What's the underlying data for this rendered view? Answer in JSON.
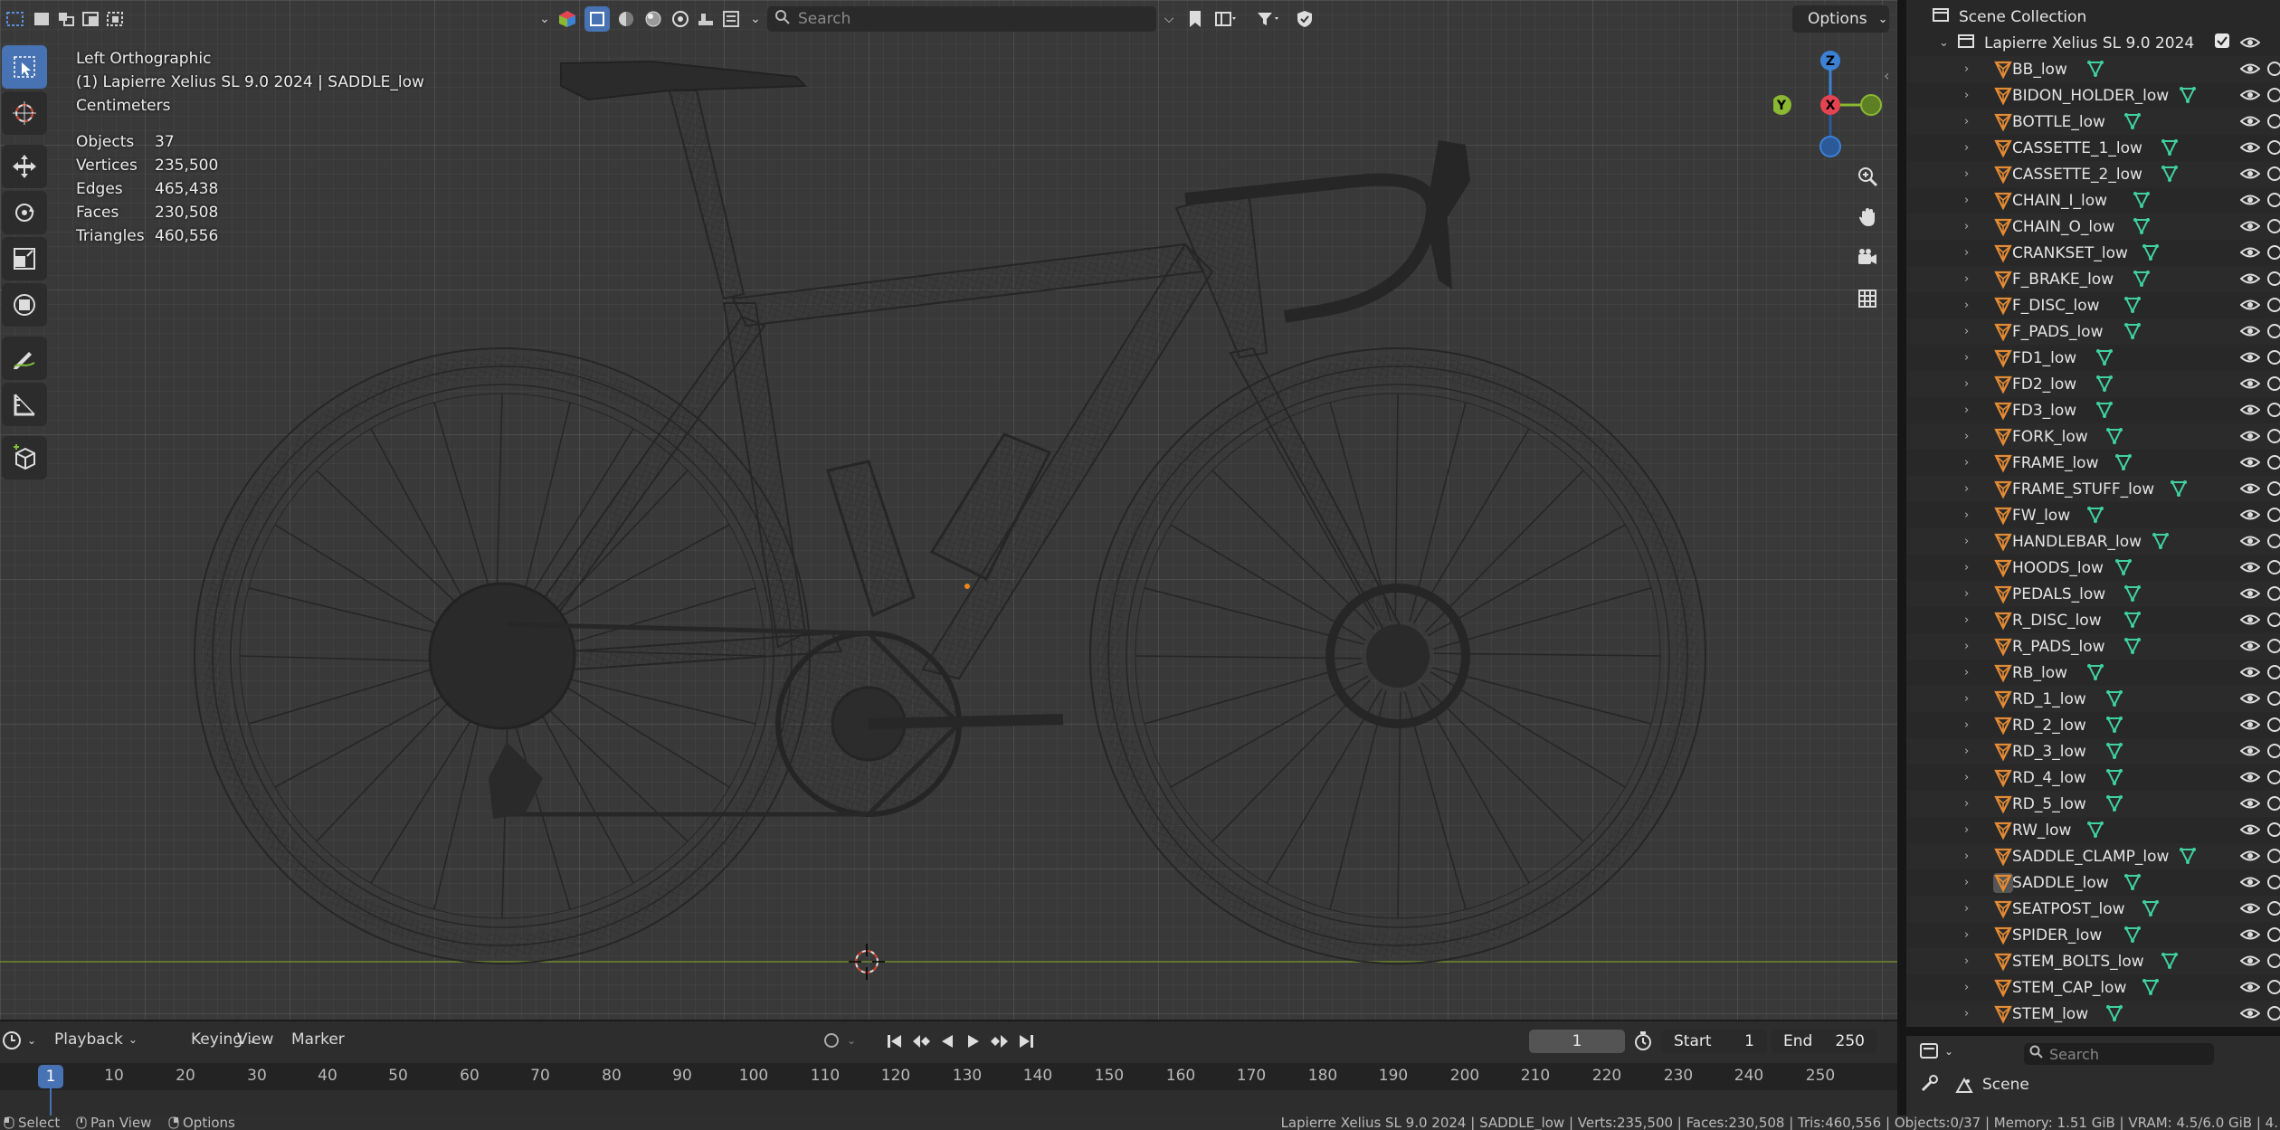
{
  "viewport": {
    "header": {
      "search_placeholder": "Search",
      "options_label": "Options"
    },
    "overlay": {
      "view_name": "Left Orthographic",
      "object_context": "(1) Lapierre Xelius SL 9.0 2024 | SADDLE_low",
      "units": "Centimeters",
      "stats": [
        {
          "label": "Objects",
          "value": "37"
        },
        {
          "label": "Vertices",
          "value": "235,500"
        },
        {
          "label": "Edges",
          "value": "465,438"
        },
        {
          "label": "Faces",
          "value": "230,508"
        },
        {
          "label": "Triangles",
          "value": "460,556"
        }
      ]
    },
    "gizmo": {
      "z": "Z",
      "y": "Y",
      "x": "X"
    }
  },
  "timeline": {
    "menus": [
      "Playback",
      "Keying",
      "View",
      "Marker"
    ],
    "current_frame": "1",
    "start_label": "Start",
    "start_value": "1",
    "end_label": "End",
    "end_value": "250",
    "ruler_ticks": [
      "1",
      "10",
      "20",
      "30",
      "40",
      "50",
      "60",
      "70",
      "80",
      "90",
      "100",
      "110",
      "120",
      "130",
      "140",
      "150",
      "160",
      "170",
      "180",
      "190",
      "200",
      "210",
      "220",
      "230",
      "240",
      "250"
    ]
  },
  "outliner": {
    "scene_collection": "Scene Collection",
    "collection_name": "Lapierre Xelius SL 9.0 2024",
    "objects": [
      "BB_low",
      "BIDON_HOLDER_low",
      "BOTTLE_low",
      "CASSETTE_1_low",
      "CASSETTE_2_low",
      "CHAIN_I_low",
      "CHAIN_O_low",
      "CRANKSET_low",
      "F_BRAKE_low",
      "F_DISC_low",
      "F_PADS_low",
      "FD1_low",
      "FD2_low",
      "FD3_low",
      "FORK_low",
      "FRAME_low",
      "FRAME_STUFF_low",
      "FW_low",
      "HANDLEBAR_low",
      "HOODS_low",
      "PEDALS_low",
      "R_DISC_low",
      "R_PADS_low",
      "RB_low",
      "RD_1_low",
      "RD_2_low",
      "RD_3_low",
      "RD_4_low",
      "RD_5_low",
      "RW_low",
      "SADDLE_CLAMP_low",
      "SADDLE_low",
      "SEATPOST_low",
      "SPIDER_low",
      "STEM_BOLTS_low",
      "STEM_CAP_low",
      "STEM_low"
    ],
    "selected_object": "SADDLE_low"
  },
  "properties": {
    "search_placeholder": "Search",
    "scene_label": "Scene"
  },
  "statusbar": {
    "select": "Select",
    "pan_view": "Pan View",
    "options": "Options",
    "info": "Lapierre Xelius SL 9.0 2024 | SADDLE_low | Verts:235,500 | Faces:230,508 | Tris:460,556 | Objects:0/37 | Memory: 1.51 GiB | VRAM: 4.5/6.0 GiB | 4."
  },
  "colors": {
    "accent": "#4772b3",
    "mesh_icon": "#e38b35",
    "modifier_icon": "#3fd1a0",
    "axis_x": "#e5434f",
    "axis_y": "#8ab832",
    "axis_z": "#3b82d6"
  }
}
